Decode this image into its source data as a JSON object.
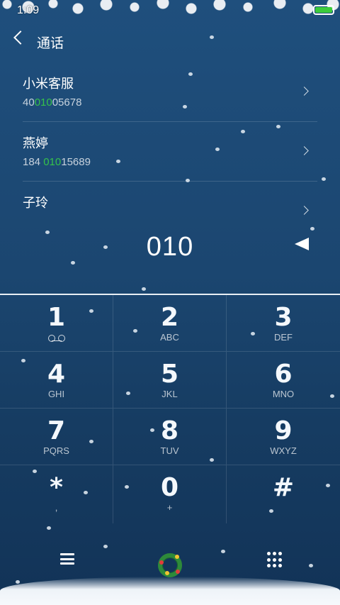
{
  "status_bar": {
    "time": "1:09",
    "battery_color": "#3ccc3c"
  },
  "header": {
    "title": "通话"
  },
  "contacts": [
    {
      "name": "小米客服",
      "number_pre": "40",
      "number_hl": "010",
      "number_post": "05678"
    },
    {
      "name": "燕婷",
      "number_pre": "184 ",
      "number_hl": "010",
      "number_post": "15689"
    },
    {
      "name": "子玲",
      "number_pre": "",
      "number_hl": "",
      "number_post": ""
    }
  ],
  "dialer": {
    "input": "010"
  },
  "keypad": [
    {
      "digit": "1",
      "letters": "",
      "icon": "voicemail-icon"
    },
    {
      "digit": "2",
      "letters": "ABC"
    },
    {
      "digit": "3",
      "letters": "DEF"
    },
    {
      "digit": "4",
      "letters": "GHI"
    },
    {
      "digit": "5",
      "letters": "JKL"
    },
    {
      "digit": "6",
      "letters": "MNO"
    },
    {
      "digit": "7",
      "letters": "PQRS"
    },
    {
      "digit": "8",
      "letters": "TUV"
    },
    {
      "digit": "9",
      "letters": "WXYZ"
    },
    {
      "digit": "*",
      "letters": ","
    },
    {
      "digit": "0",
      "letters": "+"
    },
    {
      "digit": "#",
      "letters": ""
    }
  ],
  "bottom_bar": {
    "icons": [
      "menu-icon",
      "wreath-icon",
      "dialpad-icon"
    ]
  },
  "colors": {
    "highlight": "#35c24a",
    "background": "#1b4670"
  }
}
